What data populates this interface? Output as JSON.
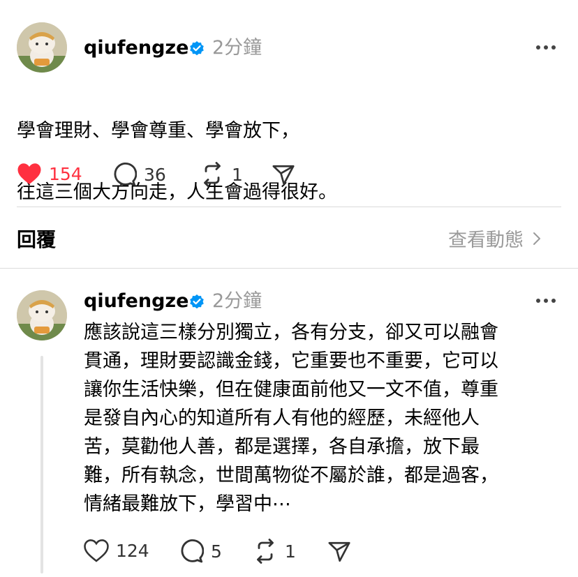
{
  "post": {
    "username": "qiufengze",
    "time": "2分鐘",
    "text_line1": "學會理財、學會尊重、學會放下，",
    "text_line2": "往這三個大方向走，人生會過得很好。",
    "likes": "154",
    "comments": "36",
    "reposts": "1"
  },
  "replies_section": {
    "title": "回覆",
    "activity_label": "查看動態"
  },
  "reply": {
    "username": "qiufengze",
    "time": "2分鐘",
    "text": "應該說這三樣分別獨立，各有分支，卻又可以融會\n貫通，理財要認識金錢，它重要也不重要，它可以\n讓你生活快樂，但在健康面前他又一文不值，尊重\n是發自內心的知道所有人有他的經歷，未經他人\n苦，莫勸他人善，都是選擇，各自承擔，放下最\n難，所有執念，世間萬物從不屬於誰，都是過客，\n情緒最難放下，學習中⋯",
    "likes": "124",
    "comments": "5",
    "reposts": "1"
  },
  "colors": {
    "heart_filled": "#ff3040",
    "verified": "#0095f6",
    "muted": "#999999"
  }
}
